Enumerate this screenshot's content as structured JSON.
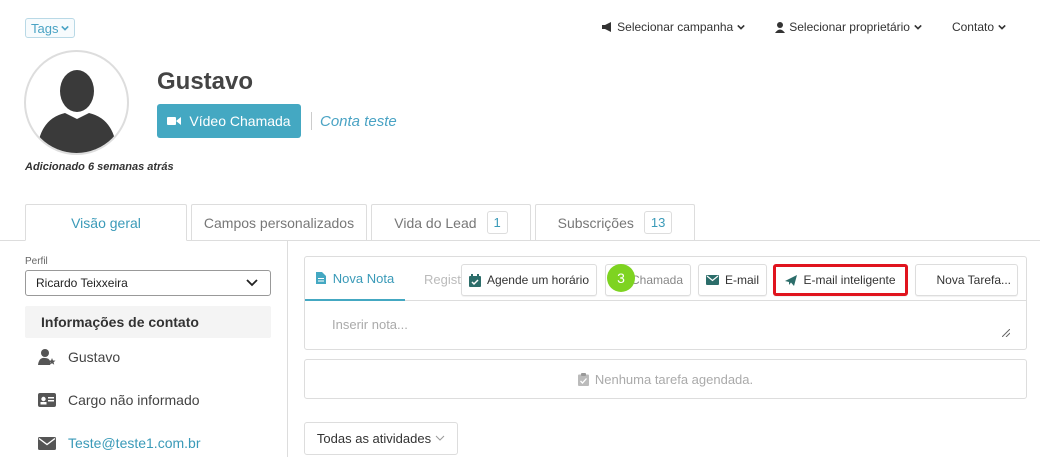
{
  "top": {
    "tags_label": "Tags",
    "menu": [
      {
        "label": "Selecionar campanha",
        "icon": "megaphone-icon"
      },
      {
        "label": "Selecionar proprietário",
        "icon": "user-icon"
      },
      {
        "label": "Contato",
        "icon": ""
      }
    ]
  },
  "profile": {
    "name": "Gustavo",
    "added_prefix": "Adicionado",
    "added_value": "6 semanas atrás",
    "video_button": "Vídeo Chamada",
    "account_link": "Conta teste"
  },
  "tabs": [
    {
      "label": "Visão geral",
      "badge": "",
      "active": true
    },
    {
      "label": "Campos personalizados",
      "badge": ""
    },
    {
      "label": "Vida do Lead",
      "badge": "1"
    },
    {
      "label": "Subscrições",
      "badge": "13"
    }
  ],
  "sidebar": {
    "perfil_label": "Perfil",
    "perfil_value": "Ricardo Teixxeira",
    "info_heading": "Informações de contato",
    "rows": [
      {
        "icon": "user-star-icon",
        "text": "Gustavo"
      },
      {
        "icon": "id-card-icon",
        "text": "Cargo não informado"
      },
      {
        "icon": "envelope-icon",
        "text": "Teste@teste1.com.br"
      }
    ]
  },
  "activity": {
    "nova_nota": "Nova Nota",
    "regi": "Registrar",
    "buttons": {
      "agende": "Agende um horário",
      "chamada": "Chamada",
      "email": "E-mail",
      "email_int": "E-mail inteligente",
      "nova_tarefa": "Nova Tarefa..."
    },
    "step_number": "3",
    "note_placeholder": "Inserir nota...",
    "no_task": "Nenhuma tarefa agendada.",
    "filter_label": "Todas as atividades"
  },
  "colors": {
    "accent": "#44a8c2",
    "link": "#3a9ab8",
    "highlight": "#e0141e",
    "step": "#7ed321"
  }
}
